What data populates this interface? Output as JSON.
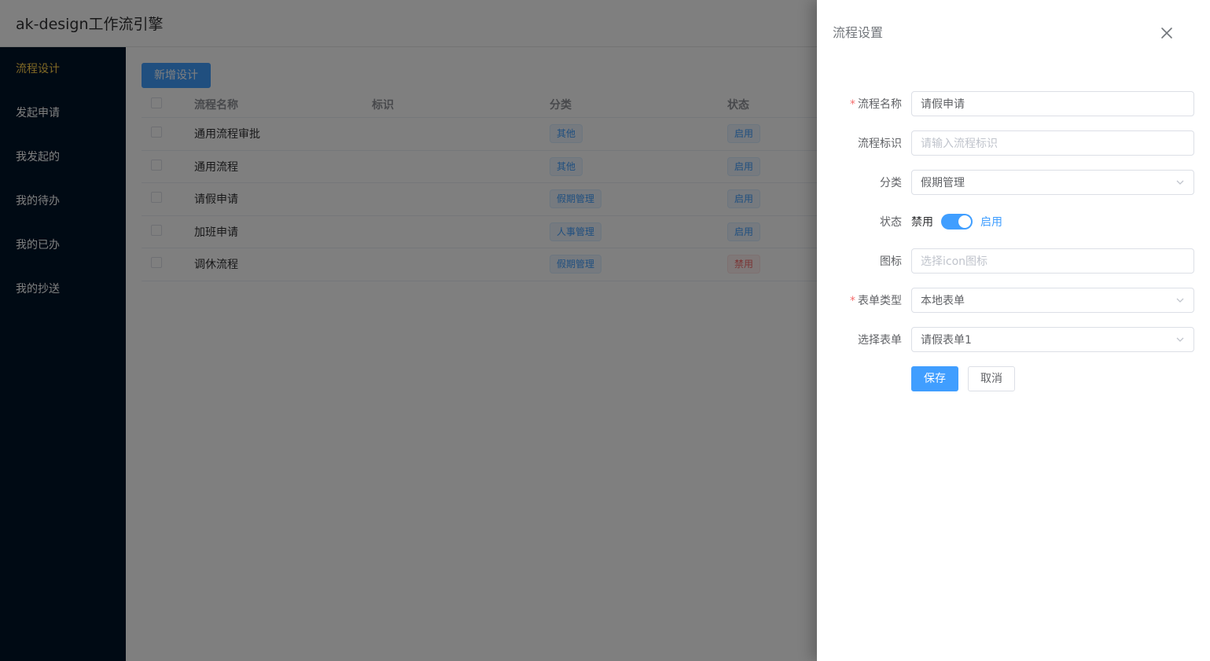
{
  "header": {
    "title": "ak-design工作流引擎"
  },
  "sidebar": {
    "items": [
      {
        "label": "流程设计",
        "active": true
      },
      {
        "label": "发起申请"
      },
      {
        "label": "我发起的"
      },
      {
        "label": "我的待办"
      },
      {
        "label": "我的已办"
      },
      {
        "label": "我的抄送"
      }
    ]
  },
  "main": {
    "add_button": "新增设计",
    "columns": {
      "name": "流程名称",
      "key": "标识",
      "category": "分类",
      "status": "状态"
    },
    "rows": [
      {
        "name": "通用流程审批",
        "key": "",
        "category": "其他",
        "status": "启用"
      },
      {
        "name": "通用流程",
        "key": "",
        "category": "其他",
        "status": "启用"
      },
      {
        "name": "请假申请",
        "key": "",
        "category": "假期管理",
        "status": "启用"
      },
      {
        "name": "加班申请",
        "key": "",
        "category": "人事管理",
        "status": "启用"
      },
      {
        "name": "调休流程",
        "key": "",
        "category": "假期管理",
        "status": "禁用"
      }
    ]
  },
  "drawer": {
    "title": "流程设置",
    "form": {
      "name": {
        "label": "流程名称",
        "value": "请假申请"
      },
      "key": {
        "label": "流程标识",
        "placeholder": "请输入流程标识"
      },
      "category": {
        "label": "分类",
        "value": "假期管理"
      },
      "status": {
        "label": "状态",
        "off_text": "禁用",
        "on_text": "启用",
        "enabled": true
      },
      "icon": {
        "label": "图标",
        "placeholder": "选择icon图标"
      },
      "form_type": {
        "label": "表单类型",
        "value": "本地表单"
      },
      "form_select": {
        "label": "选择表单",
        "value": "请假表单1"
      },
      "save": "保存",
      "cancel": "取消"
    }
  },
  "colors": {
    "primary": "#409eff",
    "sidebar_bg": "#001529",
    "sidebar_active": "#ffd04b",
    "danger": "#f56c6c"
  }
}
